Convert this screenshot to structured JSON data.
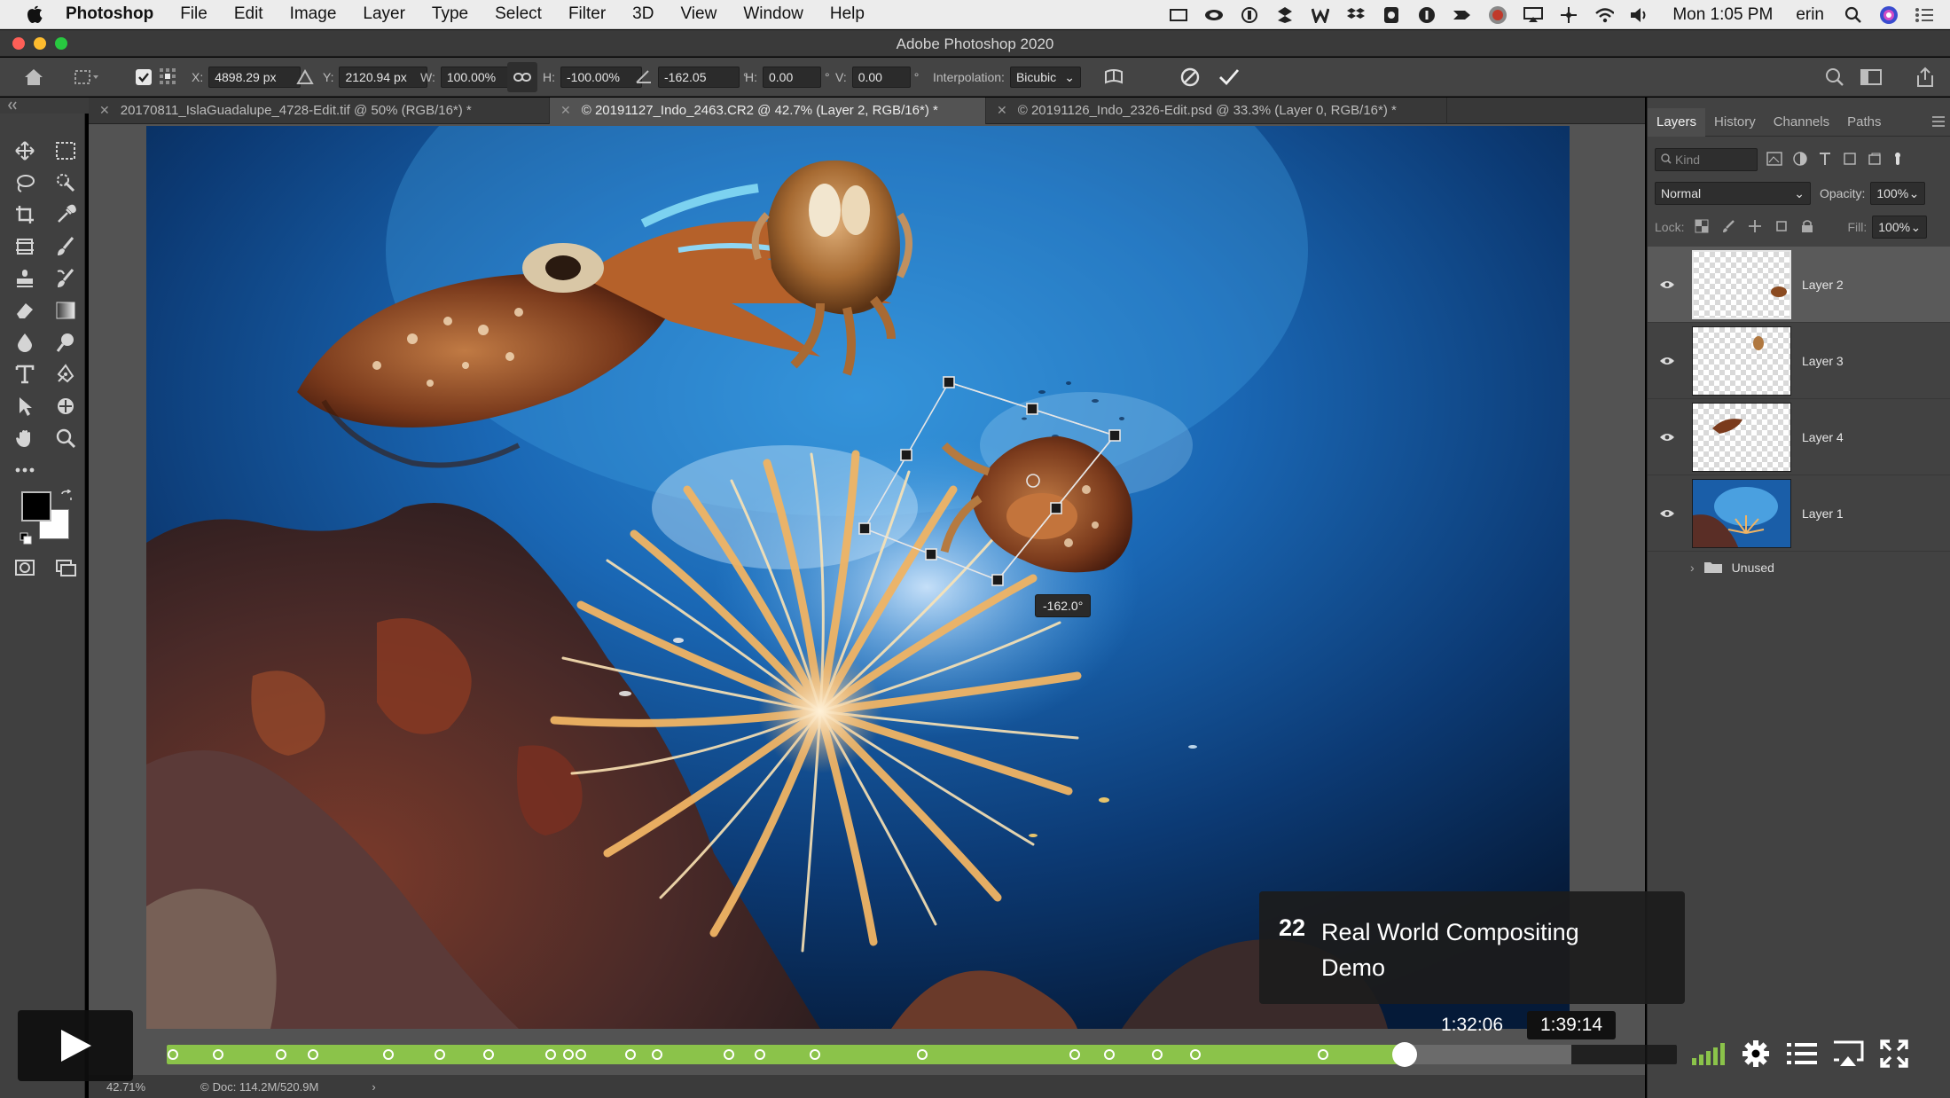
{
  "menubar": {
    "app": "Photoshop",
    "items": [
      "File",
      "Edit",
      "Image",
      "Layer",
      "Type",
      "Select",
      "Filter",
      "3D",
      "View",
      "Window",
      "Help"
    ],
    "clock": "Mon 1:05 PM",
    "user": "erin"
  },
  "window": {
    "title": "Adobe Photoshop 2020"
  },
  "options": {
    "x_label": "X:",
    "x_value": "4898.29 px",
    "y_label": "Y:",
    "y_value": "2120.94 px",
    "w_label": "W:",
    "w_value": "100.00%",
    "h_label": "H:",
    "h_value": "-100.00%",
    "angle_value": "-162.05",
    "angle_unit": "°",
    "hskew_label": "H:",
    "hskew_value": "0.00",
    "vskew_label": "V:",
    "vskew_value": "0.00",
    "interp_label": "Interpolation:",
    "interp_value": "Bicubic"
  },
  "tabs": [
    {
      "label": "20170811_IslaGuadalupe_4728-Edit.tif @ 50% (RGB/16*) *"
    },
    {
      "label": "© 20191127_Indo_2463.CR2 @ 42.7% (Layer 2, RGB/16*) *"
    },
    {
      "label": "© 20191126_Indo_2326-Edit.psd @ 33.3% (Layer 0, RGB/16*) *"
    }
  ],
  "canvas": {
    "rotation_readout": "-162.0°"
  },
  "panel": {
    "tabs": [
      "Layers",
      "History",
      "Channels",
      "Paths"
    ],
    "filter_placeholder": "Kind",
    "blend_mode": "Normal",
    "opacity_label": "Opacity:",
    "opacity_value": "100%",
    "lock_label": "Lock:",
    "fill_label": "Fill:",
    "fill_value": "100%",
    "layers": [
      {
        "name": "Layer 2",
        "selected": true
      },
      {
        "name": "Layer 3",
        "selected": false
      },
      {
        "name": "Layer 4",
        "selected": false
      },
      {
        "name": "Layer 1",
        "selected": false
      }
    ],
    "group": "Unused"
  },
  "status": {
    "zoom": "42.71%",
    "doc": "Doc: 114.2M/520.9M"
  },
  "video": {
    "chapter_number": "22",
    "chapter_title": "Real World Compositing Demo",
    "current_time": "1:32:06",
    "hover_time": "1:39:14",
    "progress_fraction": 0.82,
    "buffered_fraction": 0.93,
    "chapter_marker_fractions": [
      0.004,
      0.034,
      0.076,
      0.097,
      0.147,
      0.181,
      0.213,
      0.254,
      0.266,
      0.274,
      0.307,
      0.325,
      0.372,
      0.393,
      0.429,
      0.5,
      0.601,
      0.624,
      0.656,
      0.681,
      0.766
    ],
    "accent_color": "#8bc34a"
  }
}
